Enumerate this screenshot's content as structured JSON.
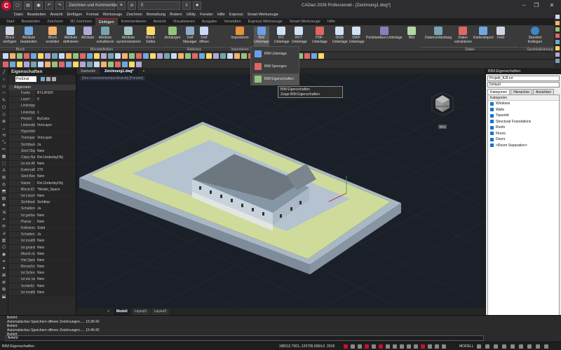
{
  "app": {
    "logo": "C",
    "quick_toolbar_dropdown": "Zeichnen und Kommentieren",
    "layer_dropdown": "0",
    "window_title": "CADian 2026 Professionell - [Zeichnung1.dwg*]"
  },
  "menubar": [
    "Datei",
    "Bearbeiten",
    "Ansicht",
    "Einfügen",
    "Format",
    "Werkzeuge",
    "Zeichnen",
    "Bemaßung",
    "Ändern",
    "Utility",
    "Fenster",
    "Hilfe",
    "Express",
    "Smart-Werkzeuge"
  ],
  "ribbon_tabs": [
    "Start",
    "Bearbeiten",
    "Zeichnen",
    "3D Zeichnen",
    "Einfügen",
    "Kommentieren",
    "Ansicht",
    "Visualisieren",
    "Ausgabe",
    "Verwalten",
    "Express Werkzeuge",
    "Smart-Werkzeuge",
    "Hilfe"
  ],
  "ribbon_active_tab": "Einfügen",
  "ribbon_buttons": {
    "block_insert": "Block einfügen",
    "attr_edit": "Attribute bearbeiten",
    "block_create": "Block erstellen",
    "attr_define": "Attribute definieren",
    "attr_manage": "Attribute",
    "attr_extract": "Attribute extrahieren",
    "attr_sync": "Attribute synchronisieren",
    "block_editor": "Block-Editor",
    "attach": "Anhängen",
    "xref_manager": "Xref Manager",
    "xref_open": "Xref öffnen",
    "import": "Importieren",
    "bim_underlay": "BIM Unterlage",
    "ifc_underlay": "IFC Unterlage",
    "rvt_underlay": "RVT Unterlage",
    "pdf_underlay": "PDF-Unterlage",
    "dgn_underlay": "DGN Unterlage",
    "dwf_underlay": "DWF Unterlage",
    "pointcloud_underlay": "Punktwolken-Unterlage",
    "image": "Bild",
    "data_link": "Datenverbindung",
    "data_extract": "Daten extrahieren",
    "map_import": "Kartenimport",
    "field": "Feld",
    "location": "Standort festlegen"
  },
  "ribbon_groups": [
    "Block",
    "Blockdefinition",
    "Referenz",
    "Importieren",
    "Daten",
    "Geolokalisierung"
  ],
  "bim_dropdown": {
    "items": [
      "BIM Unterlage",
      "BIM Sprengen",
      "BIM Eigenschaften"
    ],
    "tooltip_title": "BIM Eigenschaften",
    "tooltip_desc": "Zeige BIM Eigenschaften"
  },
  "properties_panel": {
    "title": "Eigenschaften",
    "selector": "PxrEinst",
    "category": "Allgemein",
    "rows": [
      {
        "k": "Farbe",
        "v": "BYLAYER"
      },
      {
        "k": "Layer",
        "v": "0"
      },
      {
        "k": "Linientyp",
        "v": ""
      },
      {
        "k": "Linientypfaktor",
        "v": "1"
      },
      {
        "k": "Plotstil",
        "v": "ByColor"
      },
      {
        "k": "Linienstärke",
        "v": "VonLayer"
      },
      {
        "k": "Hyperlink",
        "v": ""
      },
      {
        "k": "Transparenz",
        "v": "VonLayer"
      },
      {
        "k": "Sichtbarkeit",
        "v": "Ja"
      },
      {
        "k": "Sind Objekt (Ex...",
        "v": "Nein"
      },
      {
        "k": "Class Name",
        "v": "Rxt.UnderlayObj"
      },
      {
        "k": "Ist ein APIoxy",
        "v": "Nein"
      },
      {
        "k": "ExternalRecord",
        "v": "270"
      },
      {
        "k": "Sind Berechnt...",
        "v": "Nein"
      },
      {
        "k": "Name",
        "v": "Rxt.UnderlayObj"
      },
      {
        "k": "Block-ID",
        "v": "*Model_Space"
      },
      {
        "k": "Ist Löschstatus ...",
        "v": "Nein"
      },
      {
        "k": "Sichtbarkeit",
        "v": "Sichtbar"
      },
      {
        "k": "Schatten werfen",
        "v": "Ja"
      },
      {
        "k": "Ist gelöscht",
        "v": "Nein"
      },
      {
        "k": "Planar",
        "v": "Nein"
      },
      {
        "k": "Kollisionstyp",
        "v": "Solid"
      },
      {
        "k": "Schatten empf...",
        "v": "Ja"
      },
      {
        "k": "Ist modifiziert X...",
        "v": "Nein"
      },
      {
        "k": "Ist geändert",
        "v": "Nein"
      },
      {
        "k": "Macht rückgän...",
        "v": "Nein"
      },
      {
        "k": "Hat Speichere...",
        "v": "Nein"
      },
      {
        "k": "Benachrichtigt",
        "v": "Nein"
      },
      {
        "k": "Ist Schreibzuge...",
        "v": "Nein"
      },
      {
        "k": "Ist ein neues O...",
        "v": "Nein"
      },
      {
        "k": "Schließt wirklich",
        "v": "Nein"
      },
      {
        "k": "Ist modifizierte ...",
        "v": "Nein"
      }
    ]
  },
  "doc_tabs": [
    "Startseite",
    "Zeichnung1.dwg*"
  ],
  "viewport": {
    "label": "[Nur-Linienkantenlast Ansicht] [Parallel]",
    "viewcube_top": "OBEN",
    "viewcube_front": "VORNE",
    "viewcube_right": "LINKS",
    "wks": "WKS"
  },
  "layout_tabs": [
    "Modell",
    "Layout1",
    "Layout2"
  ],
  "bim_panel": {
    "title": "BIM Eigenschaften",
    "filename": "Projekt_A.B.rvt",
    "view": "Default",
    "tabs": [
      "Kategorien",
      "Hierarchie",
      "Ansichten"
    ],
    "list_header": "Kategorien",
    "categories": [
      "Windows",
      "Walls",
      "Topsolid",
      "Structural Foundations",
      "Roofs",
      "Floors",
      "Doors",
      "<Room Separation>"
    ]
  },
  "command_line": [
    "Befehl:",
    "Automatisches Speichern offener Zeichnungen..... 15:36:42",
    "Befehl:",
    "Automatisches Speichern offener Zeichnungen..... 15:46:42",
    "Befehl:"
  ],
  "command_input": "Befehl:",
  "status": {
    "text": "BIM Eigenschaften",
    "coords": "188112.7501,-125795.6564,0",
    "zoom": "2018",
    "model": "MODELL"
  }
}
